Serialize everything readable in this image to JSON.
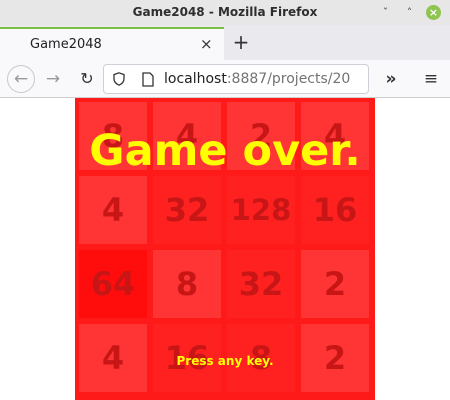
{
  "window": {
    "title": "Game2048 - Mozilla Firefox",
    "minimize_glyph": "ˇ",
    "maximize_glyph": "˄",
    "close_glyph": "×"
  },
  "tabs": [
    {
      "title": "Game2048",
      "active": true,
      "close_glyph": "×"
    }
  ],
  "new_tab_glyph": "+",
  "nav": {
    "back_glyph": "←",
    "forward_glyph": "→",
    "reload_glyph": "↻",
    "url_host": "localhost",
    "url_rest": ":8887/projects/20",
    "overflow_glyph": "»",
    "menu_glyph": "≡"
  },
  "game": {
    "tiles": [
      "8",
      "4",
      "2",
      "4",
      "4",
      "32",
      "128",
      "16",
      "64",
      "8",
      "32",
      "2",
      "4",
      "16",
      "8",
      "2"
    ],
    "overlay_message": "Game over.",
    "prompt": "Press any key.",
    "colors": {
      "background": "#ff1a1a",
      "tile": "#ff3535",
      "tile_text": "#c81616",
      "overlay_text": "#ffff00"
    }
  }
}
